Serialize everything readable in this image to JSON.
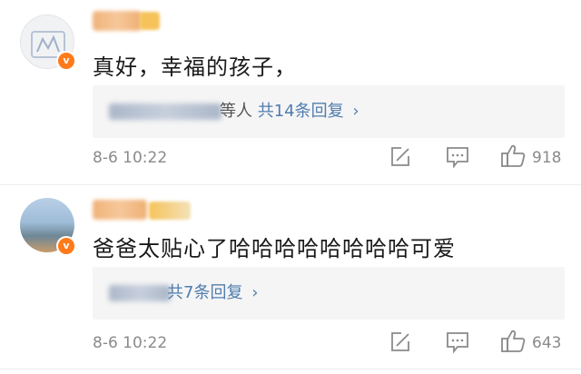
{
  "comments": [
    {
      "text": "真好，幸福的孩子，",
      "replies": {
        "who": "等人",
        "count": "共14条回复",
        "chevron": "›"
      },
      "time": "8-6 10:22",
      "likes": "918"
    },
    {
      "text": "爸爸太贴心了哈哈哈哈哈哈哈哈可爱",
      "replies": {
        "who": "",
        "count": "共7条回复",
        "chevron": "›"
      },
      "time": "8-6 10:22",
      "likes": "643"
    }
  ],
  "icons": {
    "badge": "v",
    "share": "share-icon",
    "reply": "comment-icon",
    "like": "thumbs-up-icon"
  },
  "colors": {
    "link": "#507daf",
    "muted": "#8a8a8a",
    "badge": "#ff7a1a",
    "reply_bg": "#f5f5f5"
  }
}
